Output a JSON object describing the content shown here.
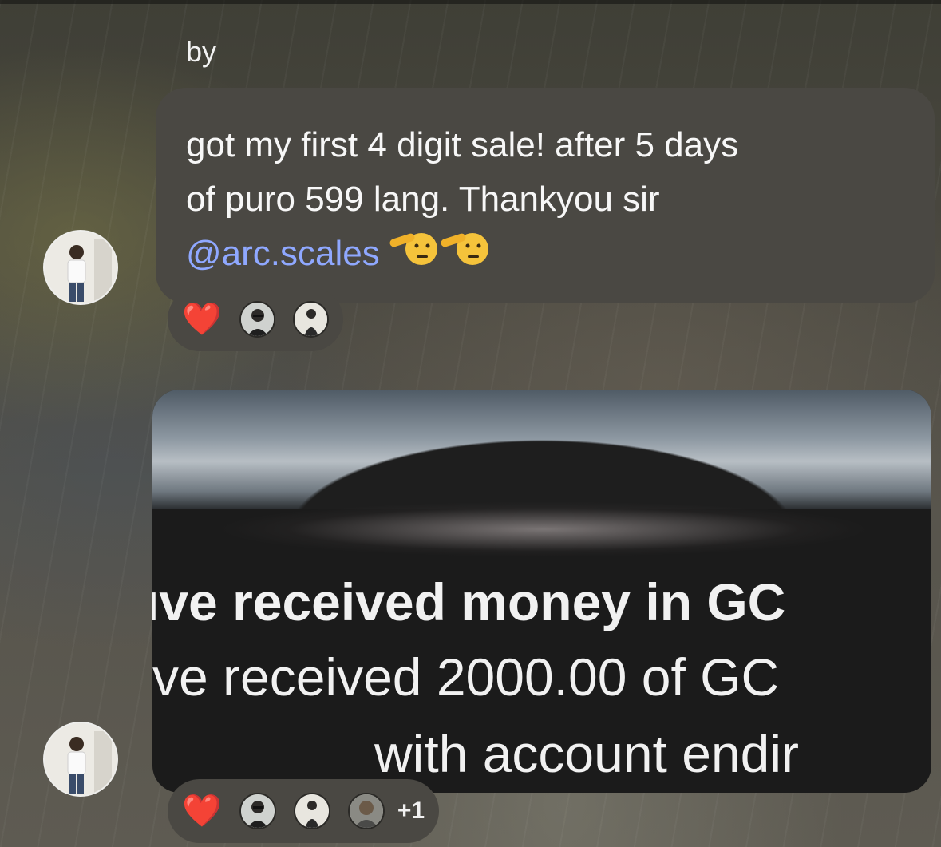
{
  "message_1": {
    "sender_prefix": "by",
    "text_lines": [
      "got my first 4 digit sale! after 5 days",
      "of puro 599 lang. Thankyou sir"
    ],
    "mention": "@arc.scales",
    "emoji": "saluting-face-icon",
    "reactions": {
      "emoji": "❤️",
      "avatars": [
        "reactor-avatar-1",
        "reactor-avatar-2"
      ]
    }
  },
  "message_2": {
    "image_text_lines": [
      "ıve received money in GC",
      "ve received 2000.00 of GC",
      "with account endir"
    ],
    "reactions": {
      "emoji": "❤️",
      "avatars": [
        "reactor-avatar-1",
        "reactor-avatar-2",
        "reactor-avatar-3"
      ],
      "extra_count": "+1"
    }
  },
  "colors": {
    "bubble": "#4a4843",
    "mention": "#8fa8ff",
    "heart": "#e0202f"
  }
}
